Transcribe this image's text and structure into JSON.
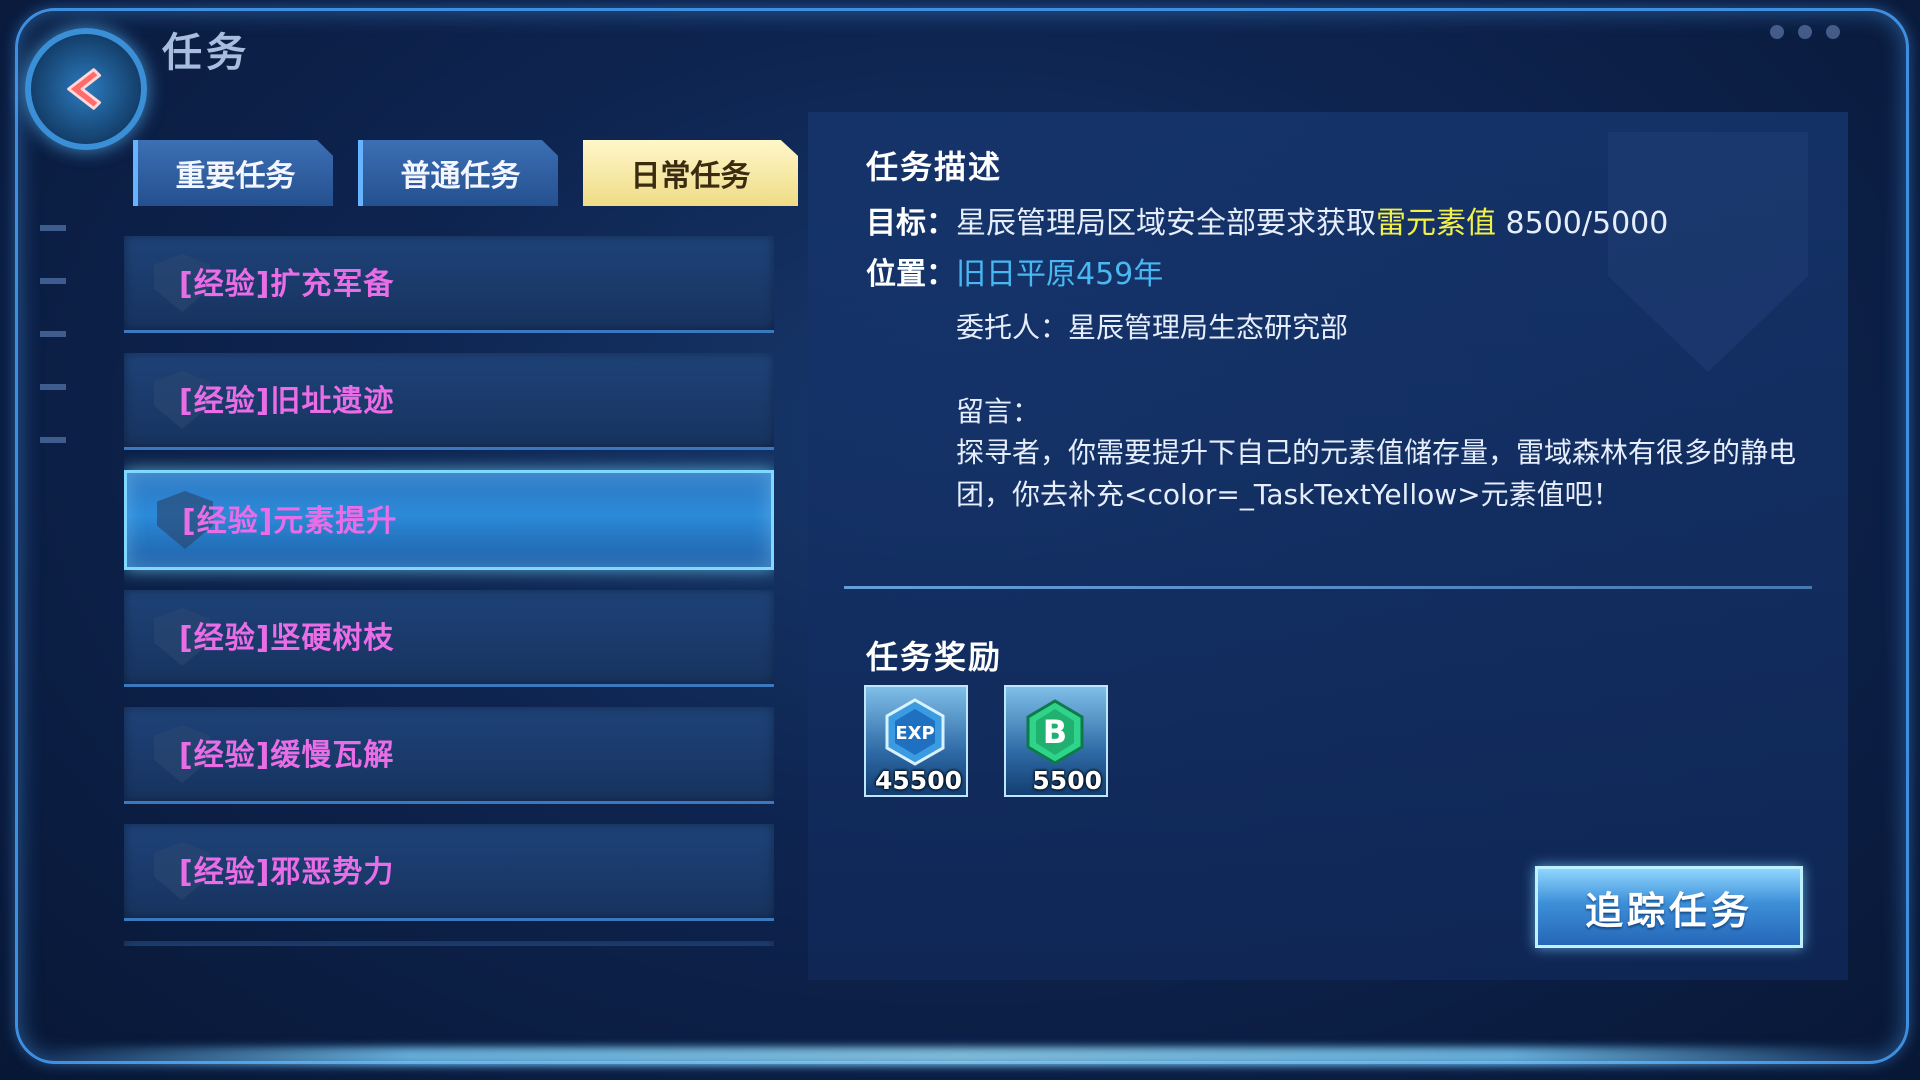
{
  "header": {
    "title": "任务"
  },
  "tabs": [
    {
      "label": "重要任务",
      "active": false
    },
    {
      "label": "普通任务",
      "active": false
    },
    {
      "label": "日常任务",
      "active": true
    }
  ],
  "quests": [
    {
      "label": "[经验]扩充军备",
      "selected": false
    },
    {
      "label": "[经验]旧址遗迹",
      "selected": false
    },
    {
      "label": "[经验]元素提升",
      "selected": true
    },
    {
      "label": "[经验]坚硬树枝",
      "selected": false
    },
    {
      "label": "[经验]缓慢瓦解",
      "selected": false
    },
    {
      "label": "[经验]邪恶势力",
      "selected": false
    }
  ],
  "detail": {
    "desc_title": "任务描述",
    "target_label": "目标：",
    "target_text": "星辰管理局区域安全部要求获取",
    "target_highlight": "雷元素值",
    "target_progress": " 8500/5000",
    "location_label": "位置：",
    "location_value": "旧日平原459年",
    "client": "委托人：星辰管理局生态研究部",
    "message_label": "留言：",
    "message_text": "探寻者，你需要提升下自己的元素值储存量，雷域森林有很多的静电团，你去补充<color=_TaskTextYellow>元素值吧！",
    "reward_title": "任务奖励"
  },
  "rewards": [
    {
      "icon": "exp-icon",
      "amount": "45500"
    },
    {
      "icon": "b-coin-icon",
      "amount": "5500"
    }
  ],
  "track_button": "追踪任务",
  "colors": {
    "highlight_yellow": "#f3f04a",
    "location_cyan": "#49b8f2",
    "quest_magenta": "#e96de6",
    "active_tab": "#efdc86"
  }
}
